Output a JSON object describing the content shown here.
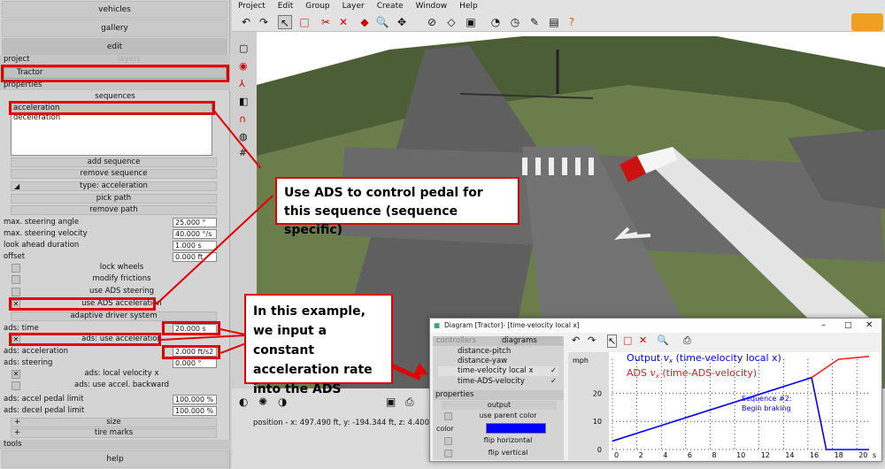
{
  "left": {
    "top_buttons": [
      "vehicles",
      "gallery",
      "edit"
    ],
    "project_label": "project",
    "layers_label": "layers",
    "selected_vehicle": "Tractor",
    "properties_label": "properties",
    "sequences_label": "sequences",
    "sequences": [
      "acceleration",
      "deceleration"
    ],
    "seq_buttons": {
      "add": "add sequence",
      "remove": "remove sequence",
      "type": "type: acceleration",
      "pick": "pick path",
      "remove_path": "remove path"
    },
    "params": [
      {
        "label": "max. steering angle",
        "value": "25.000 °"
      },
      {
        "label": "max. steering velocity",
        "value": "40.000 °/s"
      },
      {
        "label": "look ahead duration",
        "value": "1.000 s"
      },
      {
        "label": "offset",
        "value": "0.000 ft"
      }
    ],
    "checks": [
      {
        "label": "lock wheels",
        "checked": false
      },
      {
        "label": "modify frictions",
        "checked": false
      },
      {
        "label": "use ADS steering",
        "checked": false
      },
      {
        "label": "use ADS acceleration",
        "checked": true
      }
    ],
    "ads_header": "adaptive driver system",
    "ads_time_label": "ads: time",
    "ads_time_value": "20.000 s",
    "ads_use_accel": "ads: use acceleration",
    "ads_accel_label": "ads: acceleration",
    "ads_accel_value": "2.000 ft/s2",
    "ads_steer_label": "ads: steering",
    "ads_steer_value": "0.000 °",
    "ads_local_vel": "ads: local velocity x",
    "ads_backward": "ads: use accel. backward",
    "pedal": [
      {
        "label": "ads: accel pedal limit",
        "value": "100.000 %"
      },
      {
        "label": "ads: decel pedal limit",
        "value": "100.000 %"
      }
    ],
    "size_label": "size",
    "tire_marks_label": "tire marks",
    "tools_label": "tools",
    "help_label": "help"
  },
  "menu": [
    "Project",
    "Edit",
    "Group",
    "Layer",
    "Create",
    "Window",
    "Help"
  ],
  "status": "position - x: 497.490 ft, y: -194.344 ft, z: 4.400 ft",
  "callouts": {
    "c1": "Use ADS to control pedal for this sequence (sequence specific)",
    "c2": "In this example, we input a constant acceleration rate into the ADS"
  },
  "diagram": {
    "title": "Diagram [Tractor]- [time-velocity local x]",
    "tab_controllers": "controllers",
    "tab_diagrams": "diagrams",
    "list": [
      "distance-pitch",
      "distance-yaw",
      "time-velocity local x",
      "time-ADS-velocity"
    ],
    "properties": "properties",
    "output": "output",
    "use_parent_color": "use parent color",
    "color_label": "color",
    "color_value": "#0000ff",
    "flip_h": "flip horizontal",
    "flip_v": "flip vertical",
    "unit": "mph",
    "legend_output": "Output ",
    "legend_output_var": "v",
    "legend_output_sub": "x",
    "legend_output_rest": " (time-velocity local x)",
    "legend_ads": "ADS ",
    "legend_ads_rest": " (time-ADS-velocity)",
    "annot_line1": "Sequence #2:",
    "annot_line2": "Begin braking"
  },
  "chart_data": {
    "type": "line",
    "xlabel": "s",
    "ylabel": "mph",
    "x_ticks": [
      "0",
      "2",
      "4",
      "6",
      "8",
      "10",
      "12",
      "14",
      "16",
      "18",
      "20"
    ],
    "y_ticks": [
      "20",
      "10",
      "0"
    ],
    "xlim": [
      0,
      21
    ],
    "ylim": [
      0,
      32
    ],
    "series": [
      {
        "name": "Output v_x (time-velocity local x)",
        "color": "#0000ff",
        "x": [
          0,
          16.3,
          17.5,
          21
        ],
        "y": [
          3,
          25.5,
          0,
          0
        ]
      },
      {
        "name": "ADS v_x (time-ADS-velocity)",
        "color": "#ff2020",
        "x": [
          16.3,
          18.5,
          21
        ],
        "y": [
          25.5,
          32,
          33
        ]
      }
    ]
  }
}
